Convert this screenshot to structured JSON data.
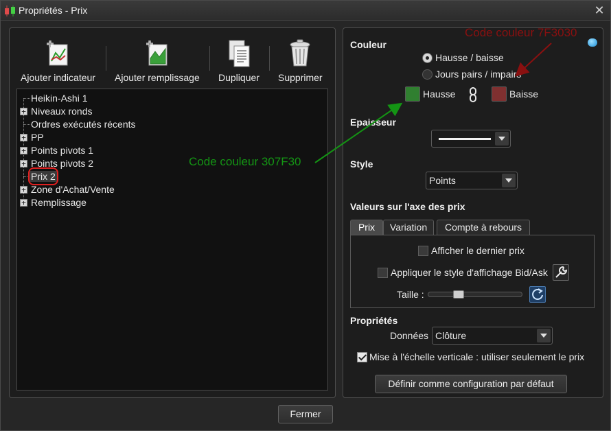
{
  "window": {
    "title": "Propriétés - Prix",
    "close_glyph": "✕"
  },
  "toolbar": {
    "add_indicator": "Ajouter indicateur",
    "add_fill": "Ajouter remplissage",
    "duplicate": "Dupliquer",
    "delete": "Supprimer"
  },
  "tree": {
    "items": [
      {
        "label": "Heikin-Ashi 1",
        "expandable": false
      },
      {
        "label": "Niveaux ronds",
        "expandable": true
      },
      {
        "label": "Ordres exécutés récents",
        "expandable": false
      },
      {
        "label": "PP",
        "expandable": true
      },
      {
        "label": "Points pivots 1",
        "expandable": true
      },
      {
        "label": "Points pivots 2",
        "expandable": true
      },
      {
        "label": "Prix 2",
        "expandable": false,
        "selected": true
      },
      {
        "label": "Zone d'Achat/Vente",
        "expandable": true
      },
      {
        "label": "Remplissage",
        "expandable": true
      }
    ],
    "expander_glyph": "+"
  },
  "color_section": {
    "title": "Couleur",
    "option_up_down": "Hausse / baisse",
    "option_even_odd": "Jours pairs / impairs",
    "up_label": "Hausse",
    "down_label": "Baisse",
    "up_color": "#307F30",
    "down_color": "#7F3030"
  },
  "thickness": {
    "title": "Epaisseur"
  },
  "style": {
    "title": "Style",
    "value": "Points"
  },
  "price_axis": {
    "title": "Valeurs sur l'axe des prix",
    "tabs": [
      "Prix",
      "Variation",
      "Compte à rebours"
    ],
    "show_last_price": "Afficher le dernier prix",
    "bid_ask_style": "Appliquer le style d'affichage Bid/Ask",
    "size_label": "Taille :",
    "size_level": 0.3
  },
  "properties": {
    "title": "Propriétés",
    "data_label": "Données",
    "data_value": "Clôture",
    "vertical_scale": "Mise à l'échelle verticale : utiliser seulement le prix",
    "default_button": "Définir comme configuration par défaut"
  },
  "footer": {
    "close_button": "Fermer"
  },
  "annotations": {
    "green_note": "Code couleur 307F30",
    "red_note": "Code couleur 7F3030",
    "green_color": "#149414",
    "red_color": "#8a1010"
  }
}
